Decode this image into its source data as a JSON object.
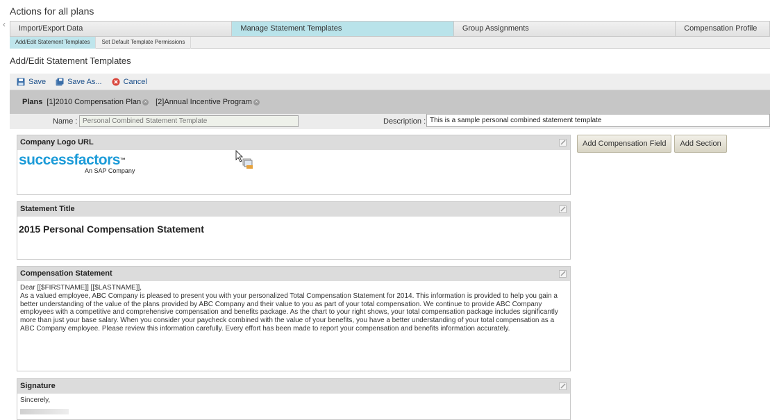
{
  "page": {
    "title": "Actions for all plans"
  },
  "nav": {
    "tabs": [
      {
        "label": "Import/Export Data"
      },
      {
        "label": "Manage Statement Templates"
      },
      {
        "label": "Group Assignments"
      },
      {
        "label": "Compensation Profile"
      }
    ],
    "subtabs": [
      {
        "label": "Add/Edit Statement Templates"
      },
      {
        "label": "Set Default Template Permissions"
      }
    ]
  },
  "section": {
    "title": "Add/Edit Statement Templates"
  },
  "toolbar": {
    "save": "Save",
    "save_as": "Save As...",
    "cancel": "Cancel"
  },
  "plans": {
    "label": "Plans",
    "items": [
      {
        "label": "[1]2010 Compensation Plan"
      },
      {
        "label": "[2]Annual Incentive Program"
      }
    ]
  },
  "fields": {
    "name_label": "Name :",
    "name_value": "Personal Combined Statement Template",
    "description_label": "Description :",
    "description_value": "This is a sample personal combined statement template"
  },
  "panels": {
    "logo": {
      "title": "Company Logo URL",
      "logo_text": "successfactors",
      "logo_tm": "™",
      "logo_sub": "An SAP Company"
    },
    "statement_title": {
      "title": "Statement Title",
      "value": "2015 Personal Compensation Statement"
    },
    "compensation": {
      "title": "Compensation Statement",
      "greeting": "Dear [[$FIRSTNAME]] [[$LASTNAME]],",
      "body": "As a valued employee, ABC Company is pleased to present you with your personalized Total Compensation Statement for 2014. This information is provided to help you gain a better understanding of the value of the plans provided by ABC Company and their value to you as part of your total compensation. We continue to provide ABC Company employees with a competitive and comprehensive compensation and benefits package. As the chart to your right shows, your total compensation package includes significantly more than just your base salary. When you consider your paycheck combined with the value of your benefits, you have a better understanding of your total compensation as a ABC Company employee. Please review this information carefully. Every effort has been made to report your compensation and benefits information accurately."
    },
    "signature": {
      "title": "Signature",
      "value": "Sincerely,"
    }
  },
  "actions": {
    "add_field": "Add Compensation Field",
    "add_section": "Add Section"
  },
  "colors": {
    "accent": "#b9e3ea",
    "logo": "#1c9bd8",
    "link": "#1b4f8a",
    "cancel": "#d9453b"
  }
}
